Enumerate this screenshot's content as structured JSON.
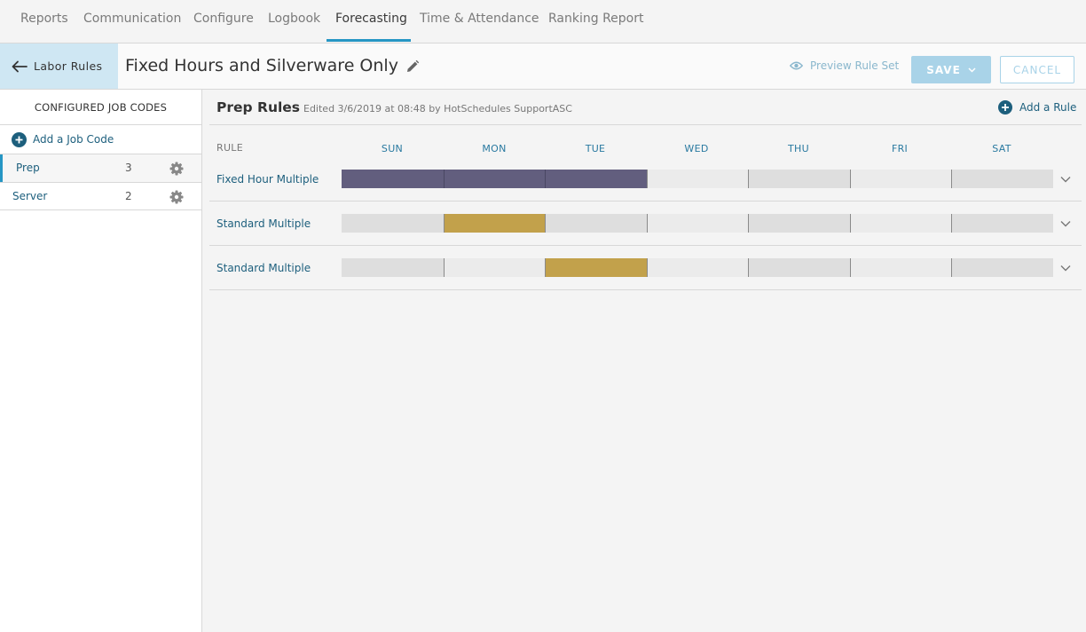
{
  "nav": {
    "tabs": [
      {
        "label": "Reports"
      },
      {
        "label": "Communication"
      },
      {
        "label": "Configure"
      },
      {
        "label": "Logbook"
      },
      {
        "label": "Forecasting"
      },
      {
        "label": "Time & Attendance"
      },
      {
        "label": "Ranking Report"
      }
    ],
    "active_tab": "Forecasting"
  },
  "header": {
    "back_label": "Labor Rules",
    "title": "Fixed Hours and Silverware Only",
    "preview_label": "Preview Rule Set",
    "save_label": "SAVE",
    "cancel_label": "CANCEL"
  },
  "sidebar": {
    "heading": "CONFIGURED JOB CODES",
    "add_label": "Add a Job Code",
    "jobs": [
      {
        "name": "Prep",
        "count": "3",
        "active": true
      },
      {
        "name": "Server",
        "count": "2",
        "active": false
      }
    ]
  },
  "main": {
    "title": "Prep Rules",
    "edited": "Edited 3/6/2019 at 08:48 by HotSchedules SupportASC",
    "add_rule_label": "Add a Rule",
    "rule_column": "RULE",
    "days": [
      "SUN",
      "MON",
      "TUE",
      "WED",
      "THU",
      "FRI",
      "SAT"
    ],
    "rules": [
      {
        "name": "Fixed Hour Multiple",
        "active_days": [
          "SUN",
          "MON",
          "TUE"
        ],
        "color": "#625e7e"
      },
      {
        "name": "Standard Multiple",
        "active_days": [
          "MON"
        ],
        "color": "#c2a14b"
      },
      {
        "name": "Standard Multiple",
        "active_days": [
          "TUE"
        ],
        "color": "#c2a14b"
      }
    ]
  },
  "colors": {
    "accent": "#2696c4",
    "link": "#1d5f7d",
    "save_bg": "#a9d3e8",
    "back_bg": "#cfe7f3"
  }
}
